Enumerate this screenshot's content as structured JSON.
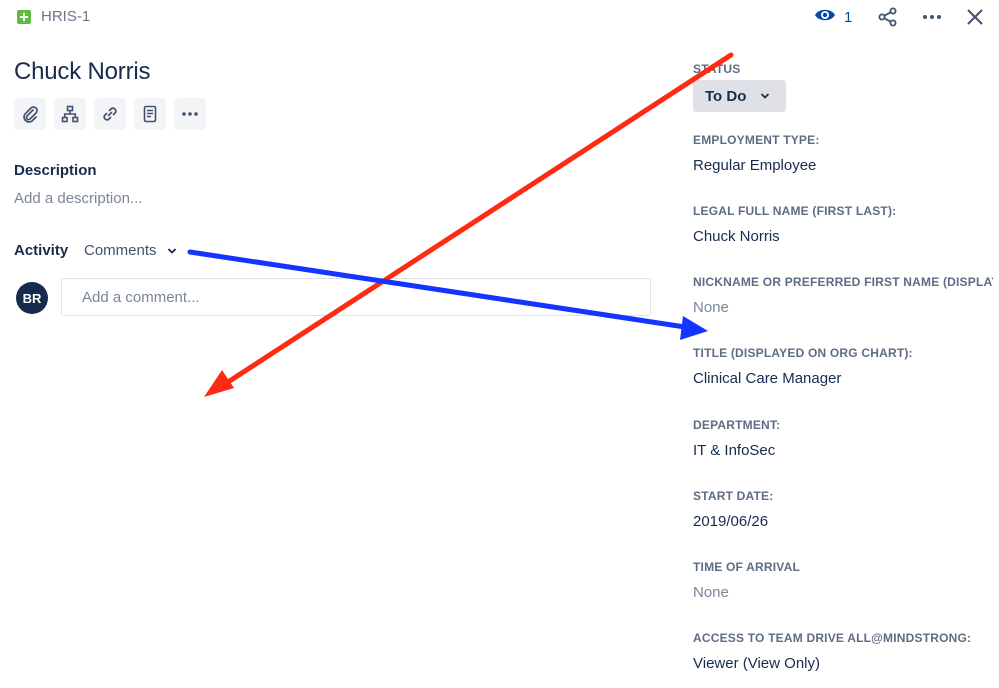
{
  "header": {
    "issue_key": "HRIS-1",
    "watch_count": "1",
    "icons": [
      "add-square-icon",
      "eye-icon",
      "share-icon",
      "more-icon",
      "close-icon"
    ],
    "accent_color": "#0747a6"
  },
  "issue": {
    "title": "Chuck Norris",
    "toolbar_icons": [
      "attachment-icon",
      "hierarchy-icon",
      "link-icon",
      "page-icon",
      "more-icon"
    ]
  },
  "description": {
    "label": "Description",
    "placeholder": "Add a description..."
  },
  "activity": {
    "label": "Activity",
    "filter": "Comments",
    "avatar_initials": "BR",
    "comment_placeholder": "Add a comment..."
  },
  "sidebar": {
    "status": {
      "label": "STATUS",
      "value": "To Do"
    },
    "fields": [
      {
        "label": "EMPLOYMENT TYPE:",
        "value": "Regular Employee",
        "muted": false
      },
      {
        "label": "LEGAL FULL NAME (FIRST LAST):",
        "value": "Chuck Norris",
        "muted": false
      },
      {
        "label": "NICKNAME OR PREFERRED FIRST NAME (DISPLAY...",
        "value": "None",
        "muted": true
      },
      {
        "label": "TITLE (DISPLAYED ON ORG CHART):",
        "value": "Clinical Care Manager",
        "muted": false
      },
      {
        "label": "DEPARTMENT:",
        "value": "IT & InfoSec",
        "muted": false
      },
      {
        "label": "START DATE:",
        "value": "2019/06/26",
        "muted": false
      },
      {
        "label": "TIME OF ARRIVAL",
        "value": "None",
        "muted": true
      },
      {
        "label": "ACCESS TO TEAM DRIVE ALL@MINDSTRONG:",
        "value": "Viewer (View Only)",
        "muted": false
      }
    ]
  },
  "annotations": {
    "red_arrow_color": "#ff2a12",
    "blue_arrow_color": "#1434ff"
  }
}
